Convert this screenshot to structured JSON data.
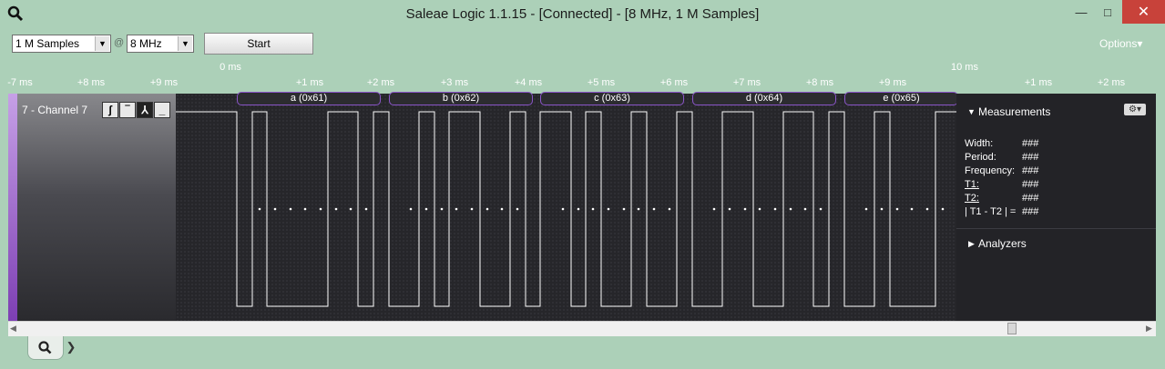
{
  "window": {
    "title": "Saleae Logic 1.1.15 - [Connected] - [8 MHz, 1 M Samples]",
    "minimize": "—",
    "maximize": "□",
    "close": "✕"
  },
  "toolbar": {
    "samples_value": "1 M Samples",
    "at_symbol": "@",
    "rate_value": "8 MHz",
    "start_label": "Start",
    "options_label": "Options▾"
  },
  "ruler": {
    "ticks": [
      "-7 ms",
      "+8 ms",
      "+9 ms",
      "+1 ms",
      "+2 ms",
      "+3 ms",
      "+4 ms",
      "+5 ms",
      "+6 ms",
      "+7 ms",
      "+8 ms",
      "+9 ms",
      "+1 ms",
      "+2 ms"
    ],
    "zero_label": "0 ms",
    "ten_label": "10 ms"
  },
  "channel": {
    "label": "7 - Channel 7",
    "trigger_buttons": [
      "ʃ",
      "‾",
      "⅄",
      "_"
    ],
    "color": "#a052d8"
  },
  "decode": {
    "labels": [
      "a (0x61)",
      "b (0x62)",
      "c (0x63)",
      "d (0x64)",
      "e (0x65)"
    ]
  },
  "measurements": {
    "title": "Measurements",
    "rows": [
      {
        "label": "Width:",
        "value": "###"
      },
      {
        "label": "Period:",
        "value": "###"
      },
      {
        "label": "Frequency:",
        "value": "###"
      },
      {
        "label": "T1:",
        "value": "###"
      },
      {
        "label": "T2:",
        "value": "###"
      },
      {
        "label": "| T1 - T2 | =",
        "value": "###"
      }
    ],
    "analyzers_label": "Analyzers"
  },
  "icons": {
    "app": "magnifier-icon",
    "tab": "magnifier-icon",
    "next": "chevron-right-icon"
  }
}
